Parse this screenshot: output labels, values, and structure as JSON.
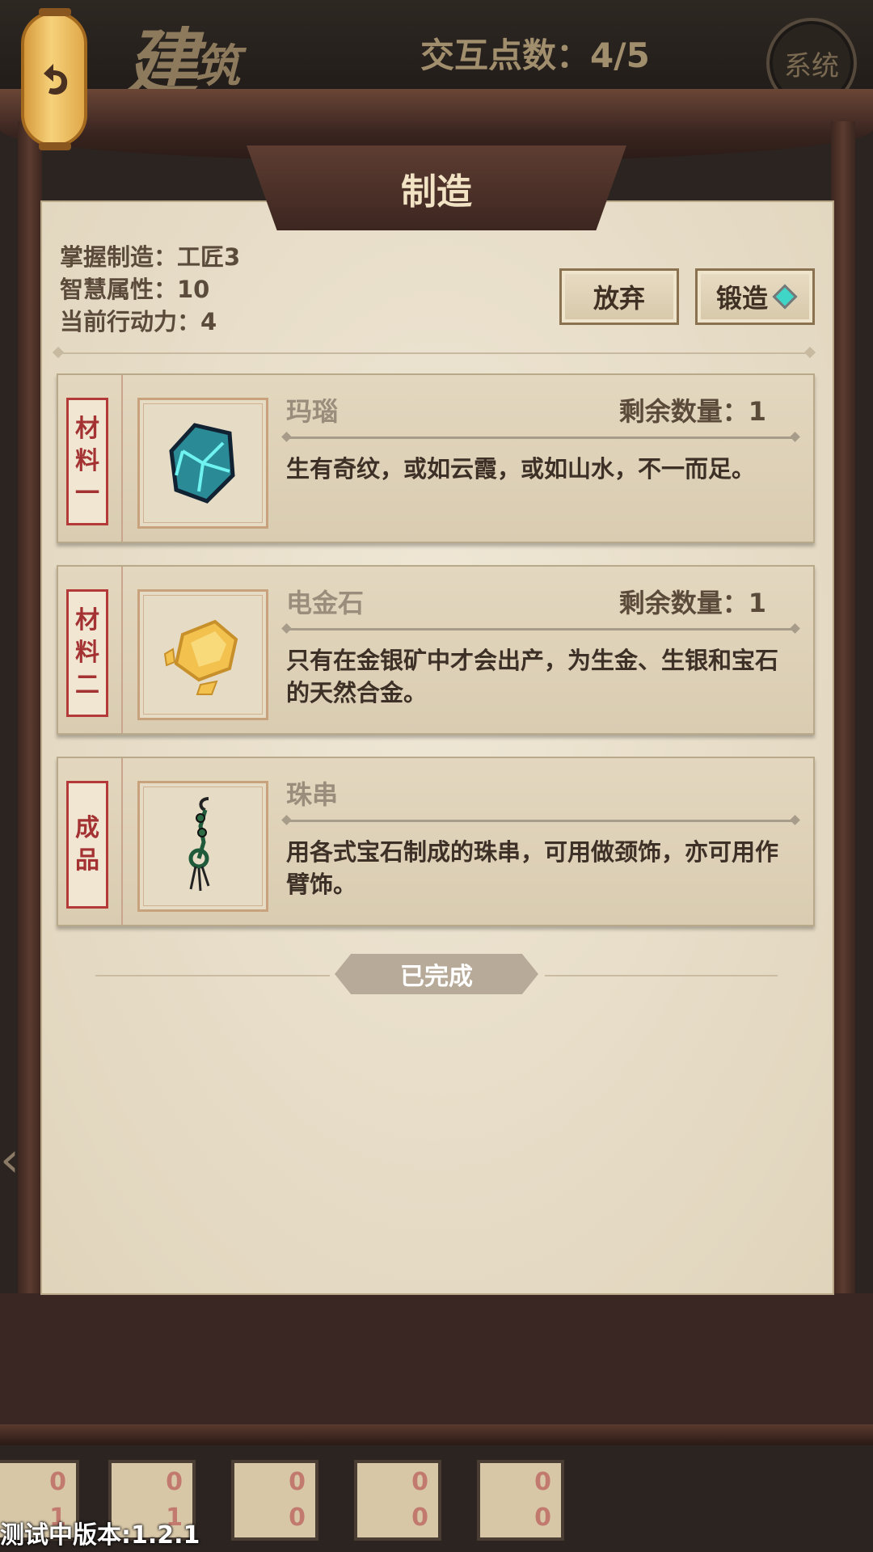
{
  "header": {
    "section_title_main": "建",
    "section_title_sub": "筑",
    "interaction_points": "交互点数：4/5",
    "system_label": "系统"
  },
  "panel": {
    "title": "制造",
    "stats": {
      "mastery": "掌握制造：工匠3",
      "wisdom": "智慧属性：10",
      "action_points": "当前行动力：4"
    },
    "buttons": {
      "abandon": "放弃",
      "forge": "锻造"
    },
    "items": [
      {
        "tag_chars": [
          "材",
          "料",
          "一"
        ],
        "name": "玛瑙",
        "qty": "剩余数量：1",
        "desc": "生有奇纹，或如云霞，或如山水，不一而足。",
        "icon": "agate-gem-icon"
      },
      {
        "tag_chars": [
          "材",
          "料",
          "二"
        ],
        "name": "电金石",
        "qty": "剩余数量：1",
        "desc": "只有在金银矿中才会出产，为生金、生银和宝石的天然合金。",
        "icon": "electrum-ore-icon"
      },
      {
        "tag_chars": [
          "成",
          "品"
        ],
        "name": "珠串",
        "qty": "",
        "desc": "用各式宝石制成的珠串，可用做颈饰，亦可用作臂饰。",
        "icon": "bead-string-icon"
      }
    ],
    "status_badge": "已完成"
  },
  "bottom_slots": [
    {
      "top": "0",
      "bottom": "1"
    },
    {
      "top": "0",
      "bottom": "1"
    },
    {
      "top": "0",
      "bottom": "0"
    },
    {
      "top": "0",
      "bottom": "0"
    },
    {
      "top": "0",
      "bottom": "0"
    }
  ],
  "version": "测试中版本:1.2.1",
  "colors": {
    "panel_bg": "#efe7d6",
    "frame_wood": "#3c2620",
    "tag_red": "#b43a3a",
    "gem_teal": "#3fd6c8",
    "gold": "#f2c14e"
  }
}
